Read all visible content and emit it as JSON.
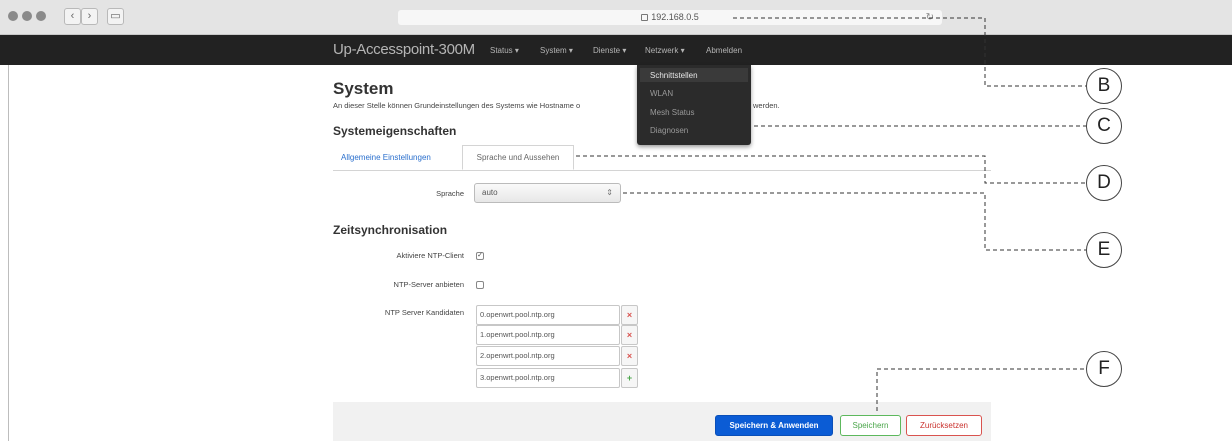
{
  "browser": {
    "address": "192.168.0.5",
    "lock_icon": "lock-icon",
    "back_label": "‹",
    "forward_label": "›",
    "sidebar_label": "▭",
    "reload_label": "↻"
  },
  "navbar": {
    "brand": "Up-Accesspoint-300M",
    "menus": [
      "Status ▾",
      "System ▾",
      "Dienste ▾",
      "Netzwerk ▾",
      "Abmelden"
    ]
  },
  "dropdown": {
    "items": [
      "Schnittstellen",
      "WLAN",
      "Mesh Status",
      "Diagnosen"
    ]
  },
  "page": {
    "title": "System",
    "description": "An dieser Stelle können Grundeinstellungen des Systems wie Hostname o",
    "description_end": "werden.",
    "section1": "Systemeigenschaften",
    "tabs": [
      "Allgemeine Einstellungen",
      "Sprache und Aussehen"
    ],
    "language_label": "Sprache",
    "language_value": "auto",
    "select_arrow": "⇕",
    "section2": "Zeitsynchronisation",
    "ntp_client_label": "Aktiviere NTP-Client",
    "ntp_client_checked": true,
    "ntp_server_label": "NTP-Server anbieten",
    "ntp_server_checked": false,
    "candidates_label": "NTP Server Kandidaten",
    "candidates": [
      "0.openwrt.pool.ntp.org",
      "1.openwrt.pool.ntp.org",
      "2.openwrt.pool.ntp.org",
      "3.openwrt.pool.ntp.org"
    ],
    "remove_symbol": "×",
    "add_symbol": "+"
  },
  "footer": {
    "apply": "Speichern & Anwenden",
    "save": "Speichern",
    "reset": "Zurücksetzen"
  },
  "callouts": [
    "B",
    "C",
    "D",
    "E",
    "F"
  ],
  "colors": {
    "navbar": "#222222",
    "primary": "#0b5cd5",
    "save": "#4aa64a",
    "reset": "#c9302c",
    "link": "#2a6fcd"
  }
}
